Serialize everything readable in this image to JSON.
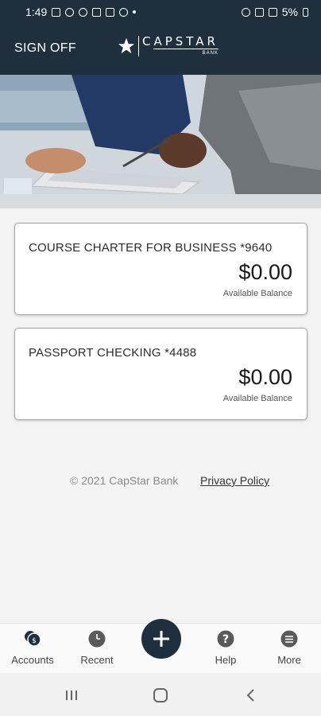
{
  "status_bar": {
    "time": "1:49",
    "battery": "5%"
  },
  "header": {
    "sign_off": "SIGN OFF",
    "logo_brand": "CAPSTAR",
    "logo_sub": "BANK"
  },
  "accounts": [
    {
      "name": "COURSE CHARTER FOR BUSINESS *9640",
      "balance": "$0.00",
      "balance_label": "Available Balance"
    },
    {
      "name": "PASSPORT CHECKING *4488",
      "balance": "$0.00",
      "balance_label": "Available Balance"
    }
  ],
  "footer": {
    "copyright": "© 2021 CapStar Bank",
    "privacy": "Privacy Policy"
  },
  "tabs": [
    {
      "label": "Accounts",
      "icon": "accounts-icon"
    },
    {
      "label": "Recent",
      "icon": "clock-icon"
    },
    {
      "label": "",
      "icon": "plus-icon"
    },
    {
      "label": "Help",
      "icon": "help-icon"
    },
    {
      "label": "More",
      "icon": "menu-icon"
    }
  ],
  "colors": {
    "brand": "#1f2f3d",
    "background": "#f3f3f3"
  }
}
